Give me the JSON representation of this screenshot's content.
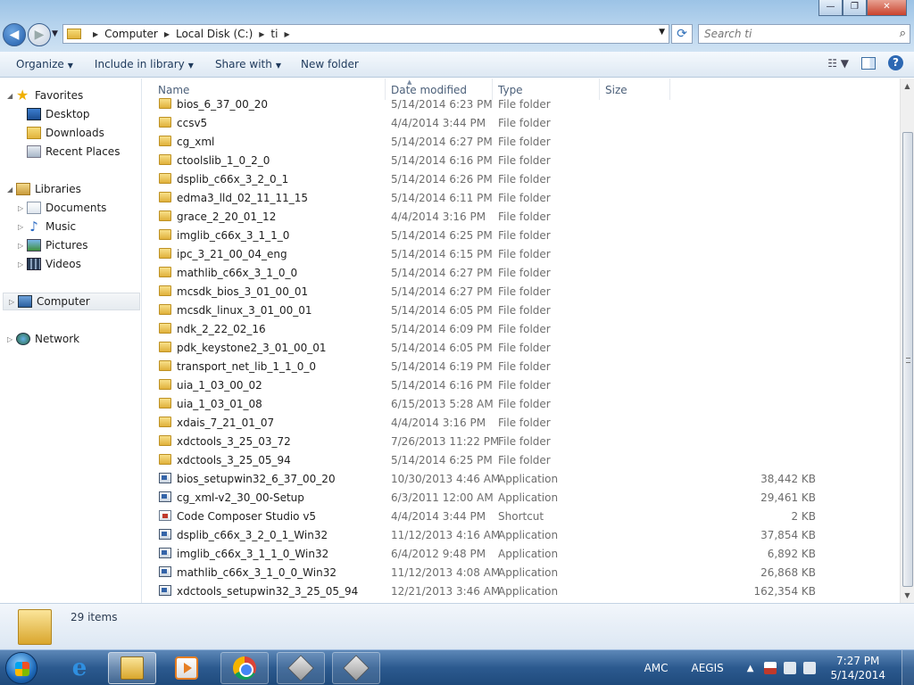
{
  "address": {
    "crumbs": [
      "Computer",
      "Local Disk (C:)",
      "ti"
    ]
  },
  "search": {
    "placeholder": "Search ti"
  },
  "window_controls": {
    "minimize": "—",
    "maximize": "❐",
    "close": "✕"
  },
  "toolbar": {
    "organize": "Organize",
    "include_in_library": "Include in library",
    "share_with": "Share with",
    "new_folder": "New folder",
    "help": "?"
  },
  "nav": {
    "favorites": "Favorites",
    "desktop": "Desktop",
    "downloads": "Downloads",
    "recent_places": "Recent Places",
    "libraries": "Libraries",
    "documents": "Documents",
    "music": "Music",
    "pictures": "Pictures",
    "videos": "Videos",
    "computer": "Computer",
    "network": "Network"
  },
  "columns": {
    "name": "Name",
    "date": "Date modified",
    "type": "Type",
    "size": "Size"
  },
  "files": [
    {
      "name": "bios_6_37_00_20",
      "date": "5/14/2014 6:23 PM",
      "type": "File folder",
      "size": "",
      "icon": "folder-icon"
    },
    {
      "name": "ccsv5",
      "date": "4/4/2014 3:44 PM",
      "type": "File folder",
      "size": "",
      "icon": "folder-icon"
    },
    {
      "name": "cg_xml",
      "date": "5/14/2014 6:27 PM",
      "type": "File folder",
      "size": "",
      "icon": "folder-icon"
    },
    {
      "name": "ctoolslib_1_0_2_0",
      "date": "5/14/2014 6:16 PM",
      "type": "File folder",
      "size": "",
      "icon": "folder-icon"
    },
    {
      "name": "dsplib_c66x_3_2_0_1",
      "date": "5/14/2014 6:26 PM",
      "type": "File folder",
      "size": "",
      "icon": "folder-icon"
    },
    {
      "name": "edma3_lld_02_11_11_15",
      "date": "5/14/2014 6:11 PM",
      "type": "File folder",
      "size": "",
      "icon": "folder-icon"
    },
    {
      "name": "grace_2_20_01_12",
      "date": "4/4/2014 3:16 PM",
      "type": "File folder",
      "size": "",
      "icon": "folder-icon"
    },
    {
      "name": "imglib_c66x_3_1_1_0",
      "date": "5/14/2014 6:25 PM",
      "type": "File folder",
      "size": "",
      "icon": "folder-icon"
    },
    {
      "name": "ipc_3_21_00_04_eng",
      "date": "5/14/2014 6:15 PM",
      "type": "File folder",
      "size": "",
      "icon": "folder-icon"
    },
    {
      "name": "mathlib_c66x_3_1_0_0",
      "date": "5/14/2014 6:27 PM",
      "type": "File folder",
      "size": "",
      "icon": "folder-icon"
    },
    {
      "name": "mcsdk_bios_3_01_00_01",
      "date": "5/14/2014 6:27 PM",
      "type": "File folder",
      "size": "",
      "icon": "folder-icon"
    },
    {
      "name": "mcsdk_linux_3_01_00_01",
      "date": "5/14/2014 6:05 PM",
      "type": "File folder",
      "size": "",
      "icon": "folder-icon"
    },
    {
      "name": "ndk_2_22_02_16",
      "date": "5/14/2014 6:09 PM",
      "type": "File folder",
      "size": "",
      "icon": "folder-icon"
    },
    {
      "name": "pdk_keystone2_3_01_00_01",
      "date": "5/14/2014 6:05 PM",
      "type": "File folder",
      "size": "",
      "icon": "folder-icon"
    },
    {
      "name": "transport_net_lib_1_1_0_0",
      "date": "5/14/2014 6:19 PM",
      "type": "File folder",
      "size": "",
      "icon": "folder-icon"
    },
    {
      "name": "uia_1_03_00_02",
      "date": "5/14/2014 6:16 PM",
      "type": "File folder",
      "size": "",
      "icon": "folder-icon"
    },
    {
      "name": "uia_1_03_01_08",
      "date": "6/15/2013 5:28 AM",
      "type": "File folder",
      "size": "",
      "icon": "folder-icon"
    },
    {
      "name": "xdais_7_21_01_07",
      "date": "4/4/2014 3:16 PM",
      "type": "File folder",
      "size": "",
      "icon": "folder-icon"
    },
    {
      "name": "xdctools_3_25_03_72",
      "date": "7/26/2013 11:22 PM",
      "type": "File folder",
      "size": "",
      "icon": "folder-icon"
    },
    {
      "name": "xdctools_3_25_05_94",
      "date": "5/14/2014 6:25 PM",
      "type": "File folder",
      "size": "",
      "icon": "folder-icon"
    },
    {
      "name": "bios_setupwin32_6_37_00_20",
      "date": "10/30/2013 4:46 AM",
      "type": "Application",
      "size": "38,442 KB",
      "icon": "application-icon"
    },
    {
      "name": "cg_xml-v2_30_00-Setup",
      "date": "6/3/2011 12:00 AM",
      "type": "Application",
      "size": "29,461 KB",
      "icon": "application-icon"
    },
    {
      "name": "Code Composer Studio v5",
      "date": "4/4/2014 3:44 PM",
      "type": "Shortcut",
      "size": "2 KB",
      "icon": "shortcut-icon"
    },
    {
      "name": "dsplib_c66x_3_2_0_1_Win32",
      "date": "11/12/2013 4:16 AM",
      "type": "Application",
      "size": "37,854 KB",
      "icon": "application-icon"
    },
    {
      "name": "imglib_c66x_3_1_1_0_Win32",
      "date": "6/4/2012 9:48 PM",
      "type": "Application",
      "size": "6,892 KB",
      "icon": "application-icon"
    },
    {
      "name": "mathlib_c66x_3_1_0_0_Win32",
      "date": "11/12/2013 4:08 AM",
      "type": "Application",
      "size": "26,868 KB",
      "icon": "application-icon"
    },
    {
      "name": "xdctools_setupwin32_3_25_05_94",
      "date": "12/21/2013 3:46 AM",
      "type": "Application",
      "size": "162,354 KB",
      "icon": "application-icon"
    }
  ],
  "details": {
    "item_count": "29 items"
  },
  "taskbar": {
    "tray_lang_1": "AMC",
    "tray_lang_2": "AEGIS",
    "time": "7:27 PM",
    "date": "5/14/2014"
  }
}
